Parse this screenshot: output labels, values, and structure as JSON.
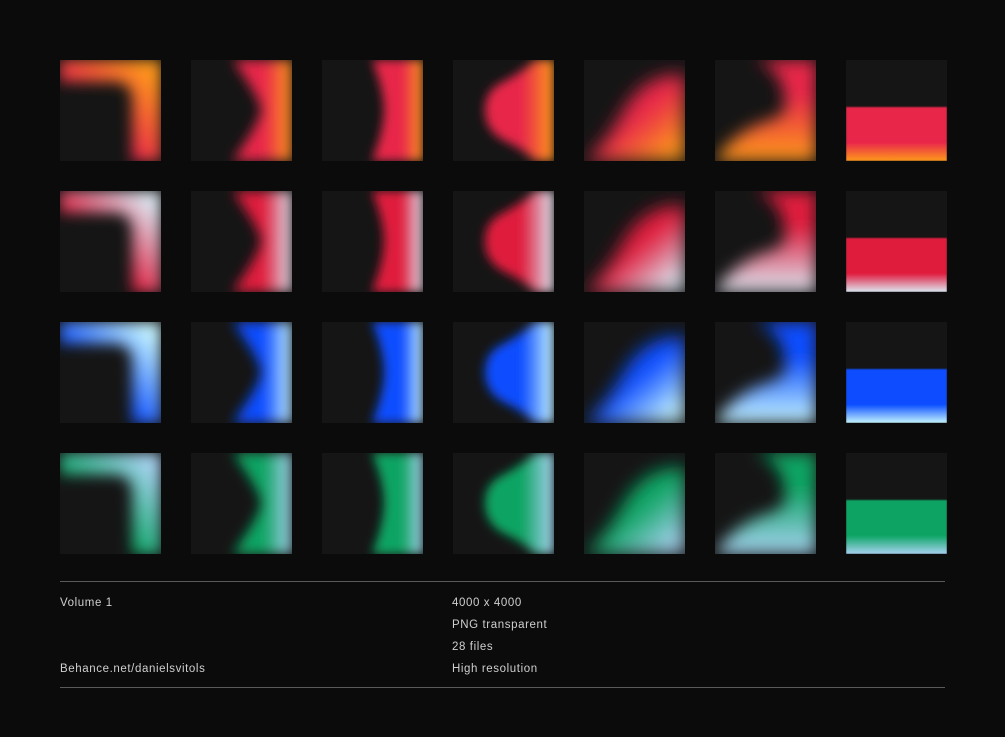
{
  "palettes": [
    {
      "name": "orange",
      "bg": "#151515",
      "mid": "#e8264a",
      "end": "#ff9a1a"
    },
    {
      "name": "pink",
      "bg": "#151515",
      "mid": "#e01a3d",
      "end": "#dce8f2"
    },
    {
      "name": "blue",
      "bg": "#151515",
      "mid": "#0a4dff",
      "end": "#c6f6ff"
    },
    {
      "name": "green",
      "bg": "#151515",
      "mid": "#0aa463",
      "end": "#a8d3f2"
    }
  ],
  "shapes": [
    "corner",
    "chevron",
    "curve",
    "wave",
    "diagonal",
    "hook",
    "band"
  ],
  "footer": {
    "left": {
      "title": "Volume 1",
      "link": "Behance.net/danielsvitols"
    },
    "right": {
      "resolution": "4000 x 4000",
      "format": "PNG transparent",
      "count": "28 files",
      "quality": "High resolution"
    }
  }
}
